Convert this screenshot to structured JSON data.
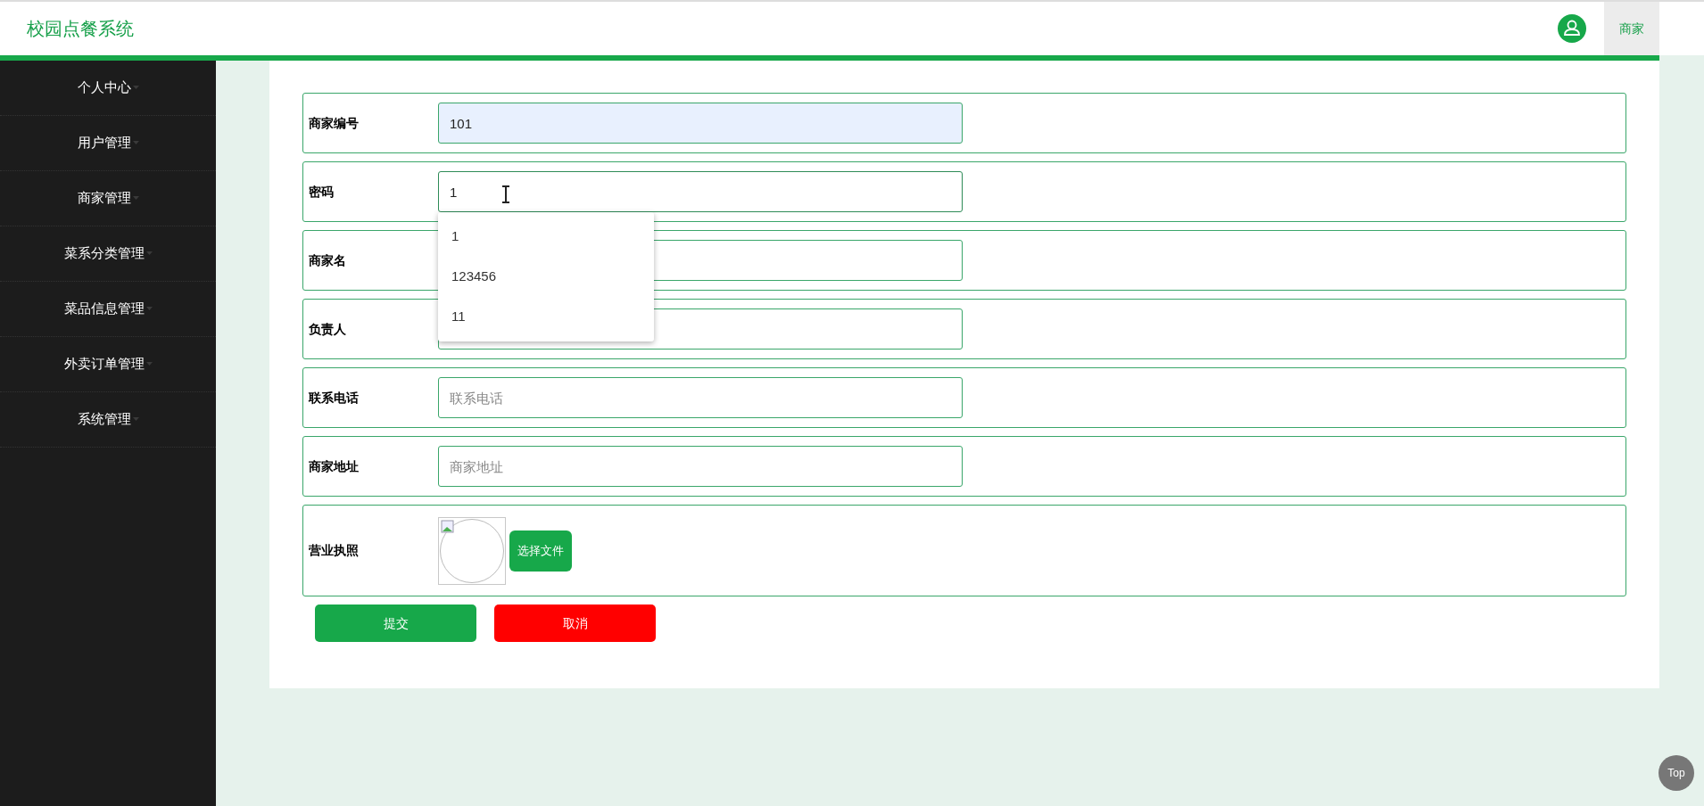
{
  "header": {
    "title": "校园点餐系统",
    "user_label": "商家"
  },
  "sidebar": {
    "items": [
      {
        "label": "个人中心"
      },
      {
        "label": "用户管理"
      },
      {
        "label": "商家管理"
      },
      {
        "label": "菜系分类管理"
      },
      {
        "label": "菜品信息管理"
      },
      {
        "label": "外卖订单管理"
      },
      {
        "label": "系统管理"
      }
    ]
  },
  "form": {
    "fields": [
      {
        "kind": "input",
        "label": "商家编号",
        "value": "101",
        "autofilled": true,
        "focused": false
      },
      {
        "kind": "input",
        "label": "密码",
        "value": "1",
        "autofilled": false,
        "focused": true,
        "suggestions": [
          "1",
          "123456",
          "11"
        ]
      },
      {
        "kind": "input",
        "label": "商家名",
        "autofilled": false,
        "focused": false
      },
      {
        "kind": "input",
        "label": "负责人",
        "autofilled": false,
        "focused": false
      },
      {
        "kind": "input",
        "label": "联系电话",
        "placeholder": "联系电话",
        "autofilled": false,
        "focused": false
      },
      {
        "kind": "input",
        "label": "商家地址",
        "placeholder": "商家地址",
        "autofilled": false,
        "focused": false
      },
      {
        "kind": "image",
        "label": "营业执照",
        "button": "选择文件"
      }
    ],
    "buttons": [
      {
        "kind": "submit",
        "label": "提交"
      },
      {
        "kind": "cancel",
        "label": "取消"
      }
    ]
  },
  "back_to_top": "Top"
}
